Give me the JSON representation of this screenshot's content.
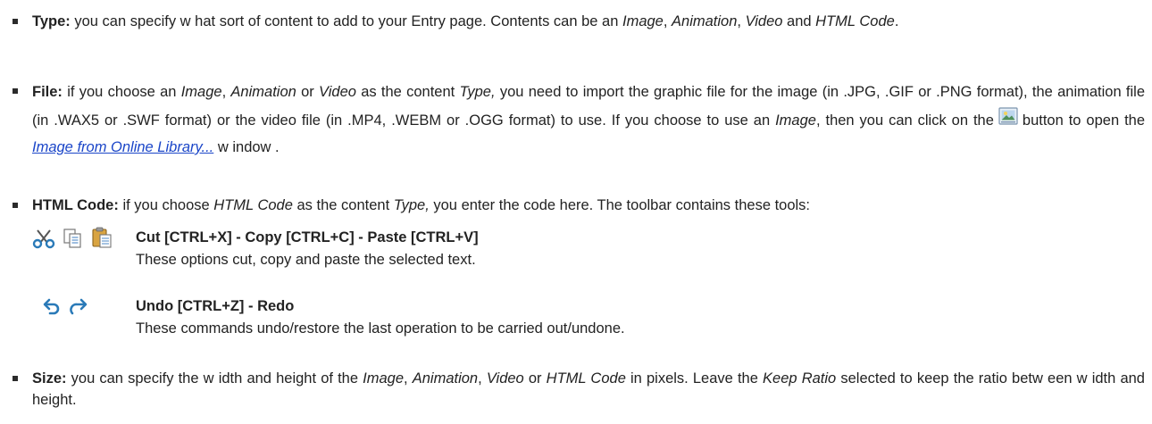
{
  "items": {
    "type": {
      "label": "Type:",
      "t1": " you can specify w hat sort of content to add to your Entry page. Contents can be an ",
      "i1": "Image",
      "t2": ", ",
      "i2": "Animation",
      "t3": ", ",
      "i3": "Video",
      "t4": " and ",
      "i4": "HTML Code",
      "t5": "."
    },
    "file": {
      "label": "File:",
      "t1": " if you choose an ",
      "i1": "Image",
      "t2": ", ",
      "i2": "Animation",
      "t3": " or ",
      "i3": "Video",
      "t4": " as the content ",
      "i4": "Type,",
      "t5": " you need to import the graphic file for the image (in .JPG, .GIF or .PNG format), the animation file (in .WAX5 or .SWF format) or the video file (in .MP4, .WEBM or .OGG format) to use. If you choose to use an ",
      "i5": "Image",
      "t6": ", then you can click on the",
      "t7": "button to open the ",
      "link": "Image from Online Library...",
      "t8": " w indow ."
    },
    "html_code": {
      "label": "HTML Code:",
      "t1": " if you choose ",
      "i1": "HTML Code",
      "t2": " as the content ",
      "i2": "Type,",
      "t3": " you enter the code here. The toolbar contains these tools:"
    },
    "size": {
      "label": "Size:",
      "t1": " you can specify the w idth and height of the ",
      "i1": "Image",
      "t2": ", ",
      "i2": "Animation",
      "t3": ", ",
      "i3": "Video",
      "t4": " or ",
      "i4": "HTML Code",
      "t5": " in pixels. Leave the ",
      "i5": "Keep Ratio",
      "t6": " selected to keep the ratio betw een w idth and height."
    }
  },
  "tools": [
    {
      "icons": [
        "scissors-icon",
        "copy-icon",
        "paste-icon"
      ],
      "title": "Cut [CTRL+X] - Copy [CTRL+C] - Paste [CTRL+V]",
      "desc": "These options cut, copy and paste the selected text."
    },
    {
      "icons": [
        "undo-icon",
        "redo-icon"
      ],
      "title": "Undo [CTRL+Z] - Redo",
      "desc": "These commands undo/restore the last operation to be carried out/undone."
    }
  ],
  "colors": {
    "link": "#1a45c8",
    "icon_blue": "#2a7ab8",
    "bullet": "#2b2b2b"
  }
}
